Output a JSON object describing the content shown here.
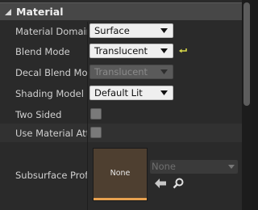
{
  "section": {
    "title": "Material"
  },
  "properties": {
    "material_domain": {
      "label": "Material Domain",
      "value": "Surface"
    },
    "blend_mode": {
      "label": "Blend Mode",
      "value": "Translucent"
    },
    "decal_blend_mode": {
      "label": "Decal Blend Mode",
      "value": "Translucent"
    },
    "shading_model": {
      "label": "Shading Model",
      "value": "Default Lit"
    },
    "two_sided": {
      "label": "Two Sided",
      "checked": false
    },
    "use_material_attributes": {
      "label": "Use Material Attributes",
      "checked": false
    },
    "subsurface_profile": {
      "label": "Subsurface Profile",
      "thumbnail_text": "None",
      "asset_value": "None"
    }
  },
  "colors": {
    "header_bg": "#474747",
    "thumbnail_bg": "#4e3f30",
    "thumbnail_bar": "#e9a24f",
    "reset_arrow": "#d9d94a"
  }
}
